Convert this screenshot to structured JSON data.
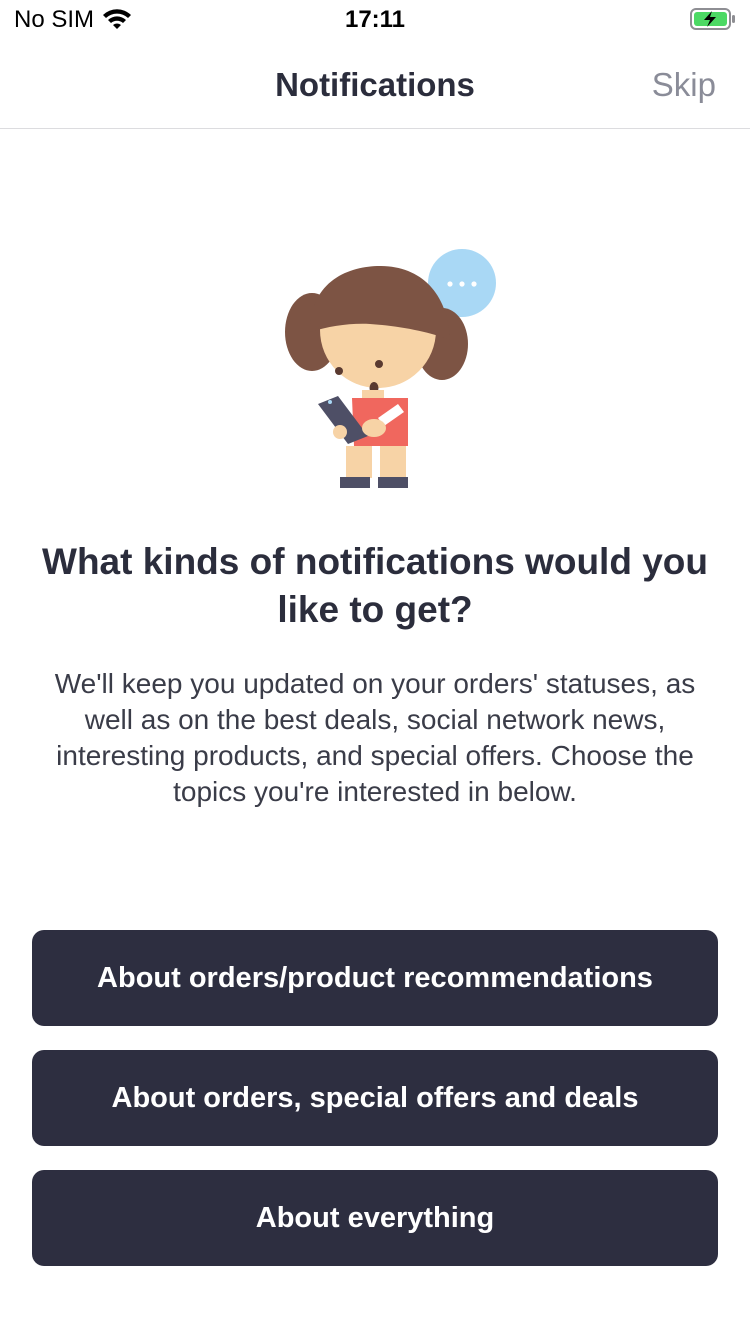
{
  "status_bar": {
    "carrier": "No SIM",
    "time": "17:11",
    "wifi_icon": "wifi-icon",
    "battery_icon": "battery-charging-icon",
    "battery_color": "#4cd964"
  },
  "nav": {
    "title": "Notifications",
    "skip_label": "Skip"
  },
  "illustration": {
    "icon": "girl-with-phone-illustration",
    "bubble_color": "#a9d8f5",
    "hair_color": "#7d5444",
    "shirt_color": "#f0675e"
  },
  "content": {
    "headline": "What kinds of notifications would you like to get?",
    "description": "We'll keep you updated on your orders' statuses, as well as on the best deals, social network news, interesting products, and special offers. Choose the topics you're interested in below."
  },
  "options": [
    {
      "label": "About orders/product recommendations"
    },
    {
      "label": "About orders, special offers and deals"
    },
    {
      "label": "About everything"
    }
  ],
  "colors": {
    "button_bg": "#2d2e40",
    "text_dark": "#2b2d3c",
    "skip_gray": "#8a8c98"
  }
}
